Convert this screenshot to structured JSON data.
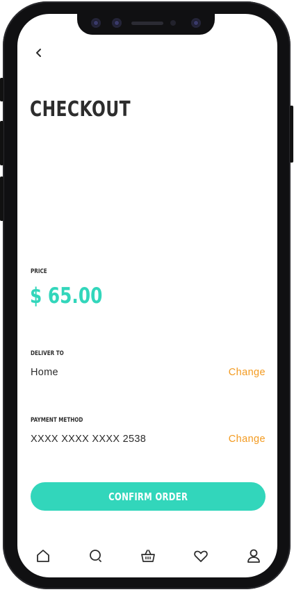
{
  "header": {
    "title": "CHECKOUT"
  },
  "price": {
    "label": "PRICE",
    "value": "$ 65.00"
  },
  "delivery": {
    "label": "DELIVER TO",
    "value": "Home",
    "change_label": "Change"
  },
  "payment": {
    "label": "PAYMENT METHOD",
    "value": "XXXX XXXX XXXX 2538",
    "change_label": "Change"
  },
  "confirm": {
    "label": "CONFIRM ORDER"
  },
  "bottom_nav": {
    "items": [
      {
        "icon": "home-icon"
      },
      {
        "icon": "search-icon"
      },
      {
        "icon": "basket-icon"
      },
      {
        "icon": "heart-icon"
      },
      {
        "icon": "user-icon"
      }
    ]
  },
  "colors": {
    "accent": "#32d6bb",
    "link": "#f39a1f",
    "text": "#2d2d2d"
  }
}
